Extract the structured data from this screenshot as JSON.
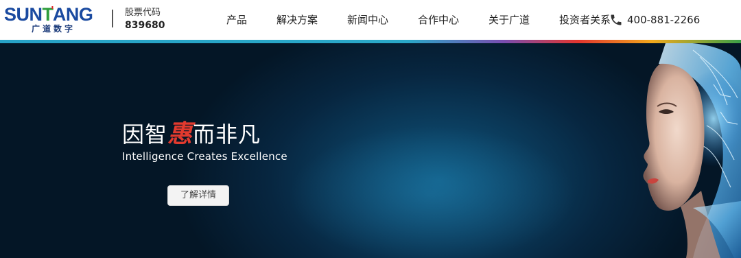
{
  "logo": {
    "main_parts": [
      "SUN",
      "T",
      "'",
      "ANG"
    ],
    "sub": "广道数字"
  },
  "stock": {
    "label": "股票代码",
    "code": "839680"
  },
  "nav": {
    "items": [
      {
        "label": "产品"
      },
      {
        "label": "解决方案"
      },
      {
        "label": "新闻中心"
      },
      {
        "label": "合作中心"
      },
      {
        "label": "关于广道"
      },
      {
        "label": "投资者关系"
      }
    ],
    "phone": "400-881-2266"
  },
  "hero": {
    "slogan_cn_before": "因智",
    "slogan_cn_highlight": "惠",
    "slogan_cn_after": "而非凡",
    "slogan_en": "Intelligence Creates Excellence",
    "button_label": "了解详情"
  },
  "colors": {
    "brand_blue": "#1a4aa0",
    "brand_green": "#2e9d3c",
    "brand_red": "#e2262b",
    "highlight_red": "#e23a2e",
    "hero_bg": "#072640"
  },
  "icons": {
    "phone": "phone-icon"
  }
}
